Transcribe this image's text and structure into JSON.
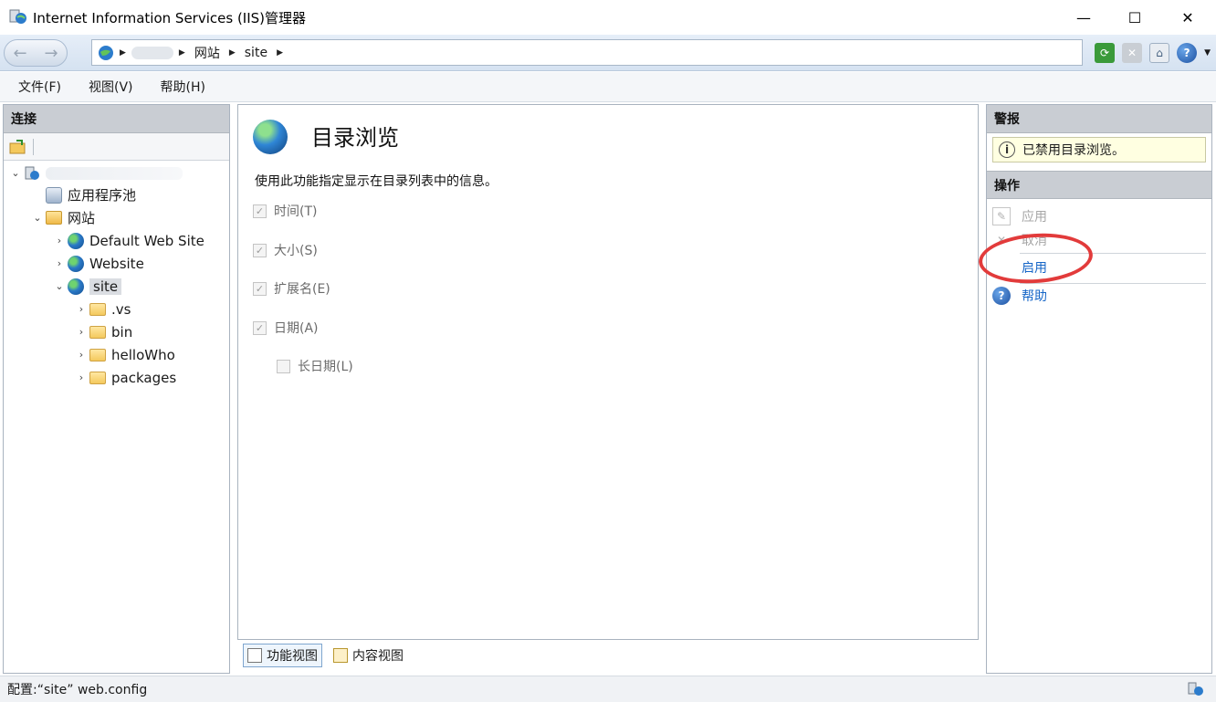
{
  "window": {
    "title": "Internet Information Services (IIS)管理器",
    "minimize": "—",
    "maximize": "☐",
    "close": "✕"
  },
  "address": {
    "crumbs": [
      "网站",
      "site"
    ]
  },
  "menu": [
    "文件(F)",
    "视图(V)",
    "帮助(H)"
  ],
  "connections": {
    "header": "连接",
    "tree": [
      {
        "label": "应用程序池"
      },
      {
        "label": "网站"
      },
      {
        "label": "Default Web Site"
      },
      {
        "label": "Website"
      },
      {
        "label": "site"
      },
      {
        "label": ".vs"
      },
      {
        "label": "bin"
      },
      {
        "label": "helloWho"
      },
      {
        "label": "packages"
      }
    ]
  },
  "feature": {
    "title": "目录浏览",
    "description": "使用此功能指定显示在目录列表中的信息。",
    "options": [
      {
        "label": "时间(T)",
        "checked": true
      },
      {
        "label": "大小(S)",
        "checked": true
      },
      {
        "label": "扩展名(E)",
        "checked": true
      },
      {
        "label": "日期(A)",
        "checked": true
      },
      {
        "label": "长日期(L)",
        "checked": false
      }
    ]
  },
  "views": {
    "feature_view": "功能视图",
    "content_view": "内容视图"
  },
  "alerts": {
    "header": "警报",
    "message": "已禁用目录浏览。"
  },
  "actions": {
    "header": "操作",
    "apply": "应用",
    "cancel": "取消",
    "enable": "启用",
    "help": "帮助"
  },
  "status": {
    "text": "配置:“site” web.config"
  },
  "colors": {
    "link": "#1666c7",
    "annotation": "#e23b3b",
    "alert_bg": "#ffffe1"
  }
}
